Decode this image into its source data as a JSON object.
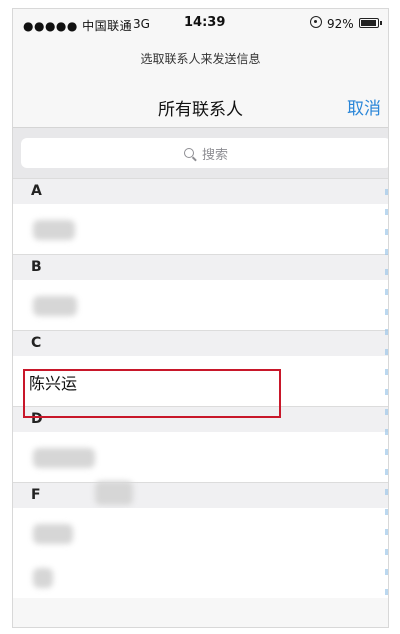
{
  "status_bar": {
    "carrier": "●●●●● 中国联通",
    "network": "3G",
    "time": "14:39",
    "battery": "92%"
  },
  "header": {
    "prompt": "选取联系人来发送信息",
    "title": "所有联系人",
    "cancel_label": "取消"
  },
  "search": {
    "placeholder": "搜索"
  },
  "sections": [
    {
      "letter": "A"
    },
    {
      "letter": "B"
    },
    {
      "letter": "C",
      "contact": "陈兴运"
    },
    {
      "letter": "D"
    },
    {
      "letter": "F"
    }
  ],
  "colors": {
    "accent": "#2a86d8",
    "highlight": "#c8172a"
  }
}
